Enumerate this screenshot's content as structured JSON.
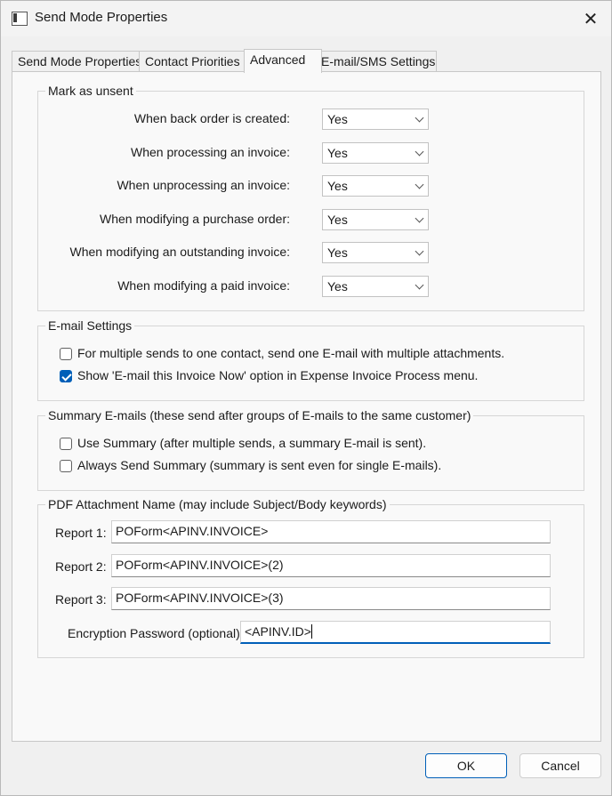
{
  "window": {
    "title": "Send Mode Properties"
  },
  "tabs": [
    {
      "label": "Send Mode Properties"
    },
    {
      "label": "Contact Priorities"
    },
    {
      "label": "Advanced"
    },
    {
      "label": "E-mail/SMS Settings"
    }
  ],
  "mark_unsent": {
    "legend": "Mark as unsent",
    "rows": [
      {
        "label": "When back order is created:",
        "value": "Yes"
      },
      {
        "label": "When processing an invoice:",
        "value": "Yes"
      },
      {
        "label": "When unprocessing an invoice:",
        "value": "Yes"
      },
      {
        "label": "When modifying a purchase order:",
        "value": "Yes"
      },
      {
        "label": "When modifying an outstanding invoice:",
        "value": "Yes"
      },
      {
        "label": "When modifying a paid invoice:",
        "value": "Yes"
      }
    ]
  },
  "email_settings": {
    "legend": "E-mail Settings",
    "options": [
      {
        "label": "For multiple sends to one contact, send one E-mail with multiple attachments.",
        "checked": false
      },
      {
        "label": "Show 'E-mail this Invoice Now' option in Expense Invoice Process menu.",
        "checked": true
      }
    ]
  },
  "summary_emails": {
    "legend": "Summary E-mails (these send after groups of E-mails to the same customer)",
    "options": [
      {
        "label": "Use Summary (after multiple sends, a summary E-mail is sent).",
        "checked": false
      },
      {
        "label": "Always Send Summary (summary is sent even for single E-mails).",
        "checked": false
      }
    ]
  },
  "pdf_attachment": {
    "legend": "PDF Attachment Name (may include Subject/Body keywords)",
    "reports": [
      {
        "label": "Report 1:",
        "value": "POForm<APINV.INVOICE>"
      },
      {
        "label": "Report 2:",
        "value": "POForm<APINV.INVOICE>(2)"
      },
      {
        "label": "Report 3:",
        "value": "POForm<APINV.INVOICE>(3)"
      }
    ],
    "encryption_label": "Encryption Password (optional):",
    "encryption_value": "<APINV.ID>"
  },
  "buttons": {
    "ok": "OK",
    "cancel": "Cancel"
  },
  "colors": {
    "accent": "#005fb8",
    "window_bg": "#f0f0f0"
  }
}
